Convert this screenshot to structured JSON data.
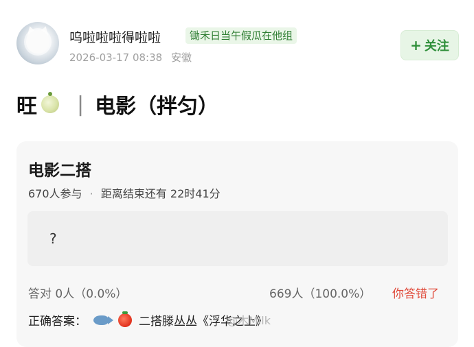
{
  "header": {
    "username": "呜啦啦啦得啦啦",
    "group_tag": "锄禾日当午假瓜在他组",
    "timestamp": "2026-03-17 08:38",
    "location": "安徽",
    "follow_label": "关注",
    "follow_plus": "+"
  },
  "post": {
    "title_prefix": "旺",
    "title_divider": "|",
    "title_main": "电影（拌匀）"
  },
  "quiz": {
    "title": "电影二搭",
    "participants": "670人参与",
    "separator": "·",
    "countdown": "距离结束还有 22时41分",
    "answer_placeholder": "?",
    "correct_stats": "答对  0人（0.0%）",
    "wrong_stats": "669人（100.0%）",
    "wrong_label": "你答错了",
    "correct_answer_label": "正确答案：",
    "correct_answer_text": "二搭滕丛丛《浮华之上》"
  },
  "watermark": "@木Milk",
  "icons": {
    "avatar": "cat-avatar",
    "title_emoji": "melon-icon",
    "answer_emoji_1": "fish-icon",
    "answer_emoji_2": "tomato-icon"
  },
  "colors": {
    "accent_green": "#2f8f3a",
    "tag_bg": "#eaf6e8",
    "wrong_red": "#e04a3a",
    "card_bg": "#f7f7f7"
  }
}
